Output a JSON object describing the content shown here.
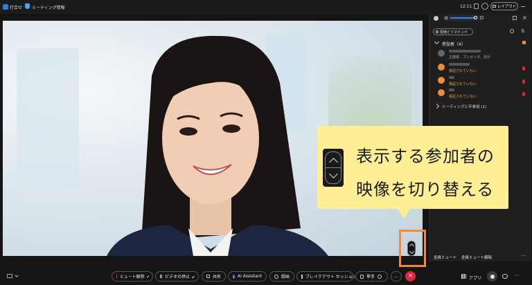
{
  "topbar": {
    "app_label": "打合せ",
    "meeting_info": "ミーティング情報",
    "time": "12:11",
    "layout_label": "レイアウト"
  },
  "panel": {
    "invite_button": "招待とリマインド",
    "participants_header": "参加者（4）",
    "host_roles": "主催者、プレゼンタ、自分",
    "unverified": "検証されていない",
    "not_joined": "ミーティングに不参加 (1)",
    "mute_all": "全員ミュート",
    "unmute_all": "全員ミュート解除"
  },
  "callout": {
    "line1": "表示する参加者の",
    "line2": "映像を切り替える"
  },
  "toolbar": {
    "unmute": "ミュート解除",
    "stop_video": "ビデオの停止",
    "share": "共有",
    "ai_assistant": "AI Assistant",
    "record": "録画",
    "breakout": "ブレイクアウト セッション",
    "raise_hand": "挙手",
    "more": "…",
    "apps": "アプリ"
  },
  "colors": {
    "accent_red": "#e5233a",
    "warn_orange": "#f0a040",
    "callout_yellow": "#ffef94",
    "highlight_orange": "#f08a3c"
  }
}
